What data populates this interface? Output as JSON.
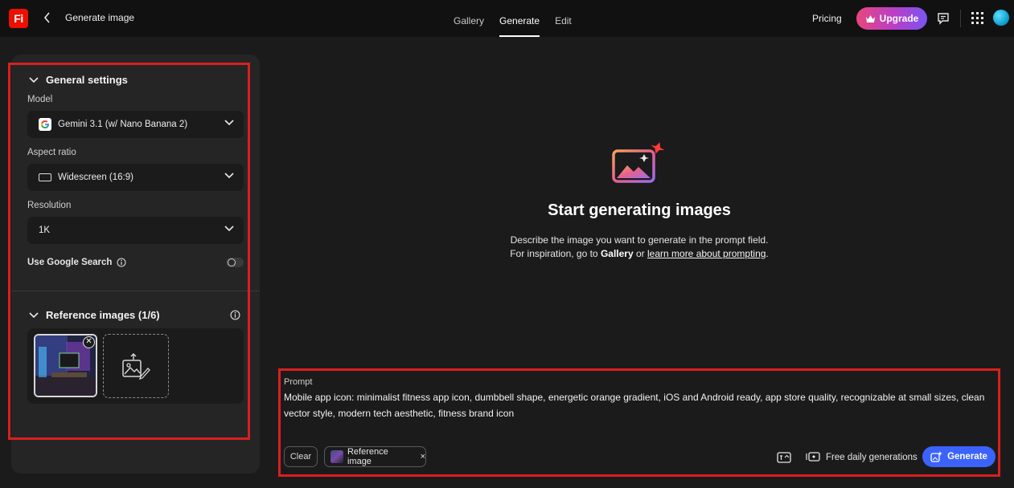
{
  "header": {
    "app_logo": "Fi",
    "title": "Generate image",
    "tabs": [
      {
        "label": "Gallery",
        "active": false
      },
      {
        "label": "Generate",
        "active": true
      },
      {
        "label": "Edit",
        "active": false
      }
    ],
    "pricing": "Pricing",
    "upgrade": "Upgrade",
    "icons": [
      "back-chevron-icon",
      "crown-icon",
      "chat-icon",
      "apps-grid-icon",
      "avatar"
    ]
  },
  "settings": {
    "general_title": "General settings",
    "model_label": "Model",
    "model_value": "Gemini 3.1 (w/ Nano Banana 2)",
    "aspect_label": "Aspect ratio",
    "aspect_value": "Widescreen (16:9)",
    "resolution_label": "Resolution",
    "resolution_value": "1K",
    "google_search_label": "Use Google Search",
    "google_search_enabled": false
  },
  "reference": {
    "title": "Reference images (1/6)"
  },
  "hero": {
    "title": "Start generating images",
    "line1": "Describe the image you want to generate in the prompt field.",
    "line2_prefix": "For inspiration, go to ",
    "line2_gallery": "Gallery",
    "line2_or": " or ",
    "line2_link": "learn more about prompting",
    "line2_end": "."
  },
  "prompt": {
    "label": "Prompt",
    "text": "Mobile app icon: minimalist fitness app icon, dumbbell shape, energetic orange gradient, iOS and Android ready, app store quality, recognizable at small sizes, clean vector style, modern tech aesthetic, fitness brand icon",
    "clear": "Clear",
    "ref_chip": "Reference image",
    "ref_chip_close": "×",
    "free_label": "Free daily generations",
    "generate": "Generate"
  },
  "colors": {
    "accent_blue": "#3b63fb",
    "highlight_red": "#d9201f",
    "logo_red": "#eb1000"
  }
}
